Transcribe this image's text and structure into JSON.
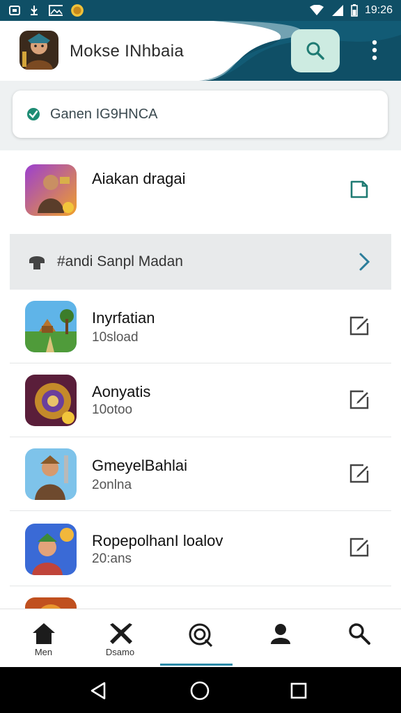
{
  "status_bar": {
    "time": "19:26",
    "icons": [
      "lock-icon",
      "usb-icon",
      "image-icon",
      "coin-icon",
      "wifi-icon",
      "signal-icon",
      "battery-icon"
    ]
  },
  "header": {
    "title": "Mokse INhbaia",
    "avatar": "game-avatar",
    "search_icon": "search-icon",
    "more_icon": "more-vertical-icon",
    "accent": "#0f4f66"
  },
  "banner": {
    "text": "Ganen IG9HNCA",
    "icon": "check-shield-icon"
  },
  "items": [
    {
      "title": "Aiakan dragai",
      "subtitle": "",
      "icon": "warrior-thumb",
      "action": "note-icon"
    },
    {
      "title": "Inyrfatian",
      "subtitle": "10sload",
      "icon": "village-thumb",
      "action": "edit-icon"
    },
    {
      "title": "Aonyatis",
      "subtitle": "10otoo",
      "icon": "armor-thumb",
      "action": "edit-icon"
    },
    {
      "title": "GmeyelBahlai",
      "subtitle": "2onlna",
      "icon": "knight-thumb",
      "action": "edit-icon"
    },
    {
      "title": "RopepolhanI loalov",
      "subtitle": "20:ans",
      "icon": "elf-thumb",
      "action": "edit-icon"
    }
  ],
  "section": {
    "label": "#andi Sanpl Madan",
    "icon": "bell-icon",
    "chevron": "chevron-right-icon"
  },
  "bottom_nav": [
    {
      "label": "Men",
      "icon": "home-icon"
    },
    {
      "label": "Dsamo",
      "icon": "games-icon"
    },
    {
      "label": "",
      "icon": "target-icon",
      "active": true
    },
    {
      "label": "",
      "icon": "profile-icon"
    },
    {
      "label": "",
      "icon": "search-icon"
    }
  ],
  "system_nav": [
    "back-icon",
    "home-circle-icon",
    "recents-icon"
  ]
}
